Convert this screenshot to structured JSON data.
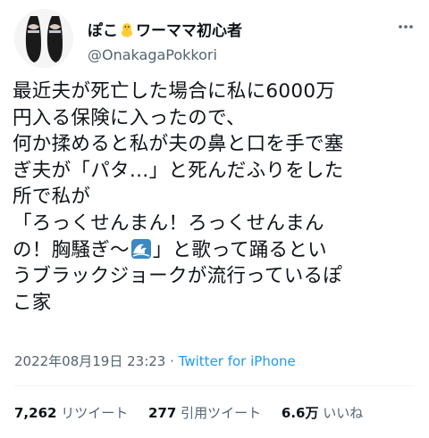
{
  "author": {
    "display_name": "ぽこ",
    "display_name_suffix": "ワーママ初心者",
    "handle": "@OnakagaPokkori",
    "name_emoji": "chick-emoji"
  },
  "tweet": {
    "lines": [
      "最近夫が死亡した場合に私に6000万",
      "円入る保険に入ったので、",
      "何か揉めると私が夫の鼻と口を手で塞",
      "ぎ夫が「パタ…」と死んだふりをした",
      "所で私が",
      "「ろっくせんまん！ろっくせんまん",
      "の！胸騒ぎ〜",
      "」と歌って踊るとい",
      "うブラックジョークが流行っているぽ",
      "こ家"
    ],
    "inline_emoji": "wave-emoji"
  },
  "meta": {
    "timestamp": "2022年08月19日 23:23",
    "separator": "·",
    "source": "Twitter for iPhone"
  },
  "stats": {
    "retweets_count": "7,262",
    "retweets_label": "リツイート",
    "quotes_count": "277",
    "quotes_label": "引用ツイート",
    "likes_count": "6.6万",
    "likes_label": "いいね"
  },
  "colors": {
    "text": "#0f1419",
    "secondary": "#536471",
    "link": "#1d9bf0",
    "divider": "#eff3f4"
  }
}
